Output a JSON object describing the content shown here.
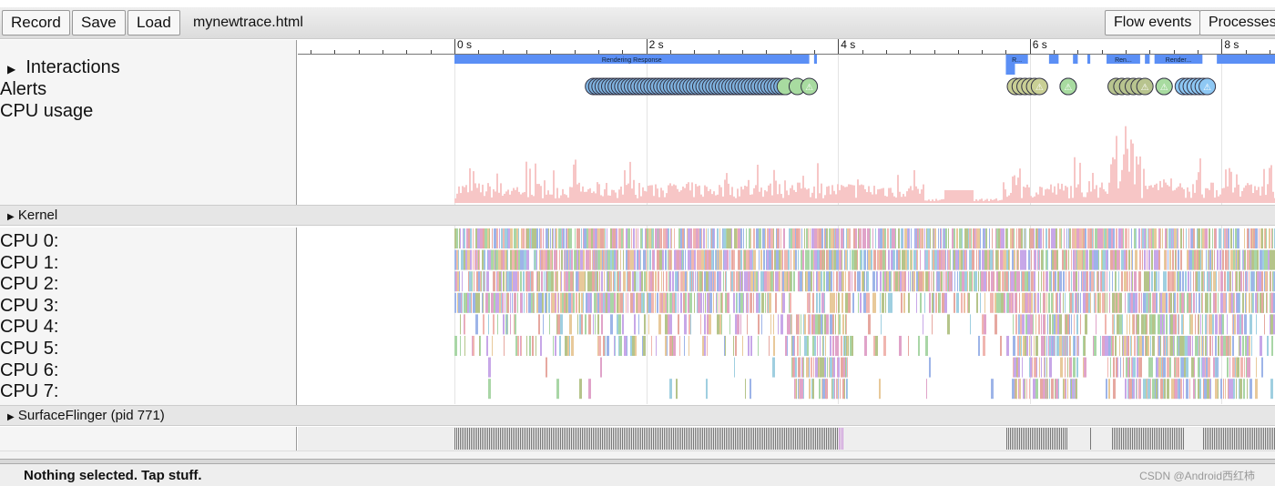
{
  "toolbar": {
    "record_label": "Record",
    "save_label": "Save",
    "load_label": "Load",
    "filename": "mynewtrace.html",
    "flow_events_label": "Flow events",
    "processes_label": "Processes"
  },
  "ruler": {
    "ticks": [
      "0 s",
      "2 s",
      "4 s",
      "6 s",
      "8 s"
    ]
  },
  "tracks": {
    "interactions": "Interactions",
    "alerts": "Alerts",
    "cpu_usage": "CPU usage"
  },
  "interactions": [
    {
      "label": "Rendering Response",
      "start": 0,
      "end": 3.7
    },
    {
      "label": "R...",
      "start": 5.75,
      "end": 5.98
    },
    {
      "label": "Ren...",
      "start": 6.8,
      "end": 7.15
    },
    {
      "label": "Render...",
      "start": 7.3,
      "end": 7.8
    },
    {
      "label": "",
      "start": 7.95,
      "end": 8.6
    }
  ],
  "kernel": {
    "label": "Kernel",
    "cpus": [
      "CPU 0:",
      "CPU 1:",
      "CPU 2:",
      "CPU 3:",
      "CPU 4:",
      "CPU 5:",
      "CPU 6:",
      "CPU 7:"
    ]
  },
  "process": {
    "label": "SurfaceFlinger (pid 771)"
  },
  "bottom": {
    "status": "Nothing selected. Tap stuff."
  },
  "watermark": "CSDN @Android西红柿",
  "colors": {
    "interaction": "#5b8ff5",
    "cpu_usage": "#f7c6c6",
    "alert_green": "#a8dba0",
    "alert_blue": "#8ec8f4"
  }
}
